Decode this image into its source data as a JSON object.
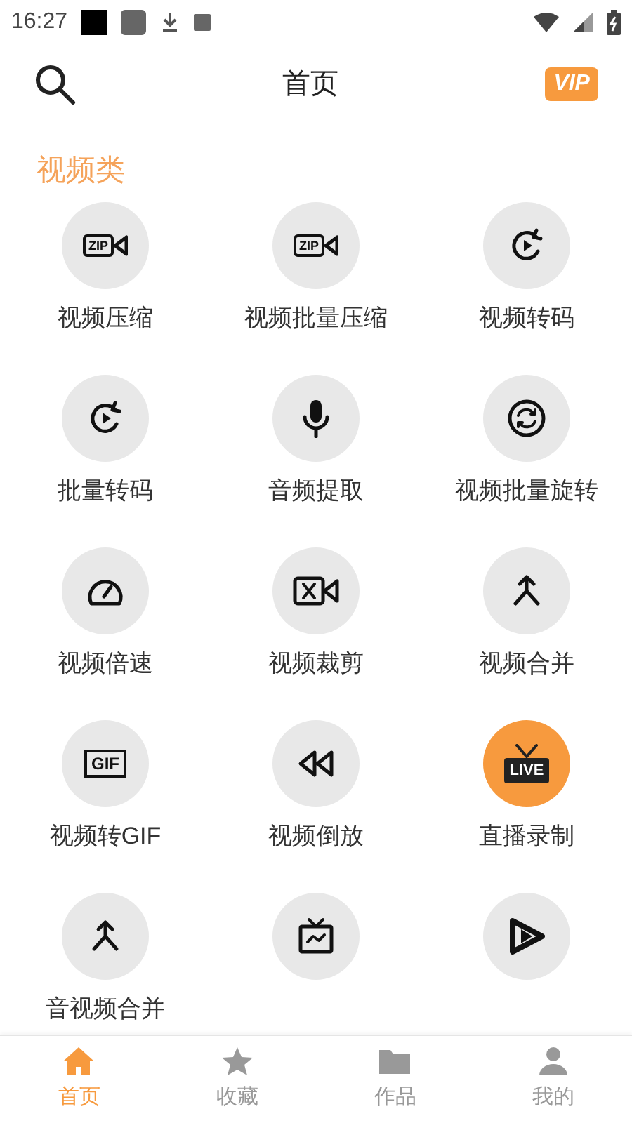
{
  "status_bar": {
    "time": "16:27"
  },
  "header": {
    "title": "首页",
    "vip_badge": "VIP"
  },
  "section": {
    "title": "视频类"
  },
  "tools": [
    {
      "label": "视频压缩",
      "kind": "zip",
      "icon_text": "ZIP",
      "color": "#e8e8e8"
    },
    {
      "label": "视频批量压缩",
      "kind": "zip",
      "icon_text": "ZIP",
      "color": "#e8e8e8"
    },
    {
      "label": "视频转码",
      "kind": "convert",
      "color": "#e8e8e8"
    },
    {
      "label": "批量转码",
      "kind": "convert",
      "color": "#e8e8e8"
    },
    {
      "label": "音频提取",
      "kind": "mic",
      "color": "#e8e8e8"
    },
    {
      "label": "视频批量旋转",
      "kind": "rotate",
      "color": "#e8e8e8"
    },
    {
      "label": "视频倍速",
      "kind": "speed",
      "color": "#e8e8e8"
    },
    {
      "label": "视频裁剪",
      "kind": "cut",
      "color": "#e8e8e8"
    },
    {
      "label": "视频合并",
      "kind": "merge",
      "color": "#e8e8e8"
    },
    {
      "label": "视频转GIF",
      "kind": "gif",
      "icon_text": "GIF",
      "color": "#e8e8e8"
    },
    {
      "label": "视频倒放",
      "kind": "rewind",
      "color": "#e8e8e8"
    },
    {
      "label": "直播录制",
      "kind": "live",
      "icon_text": "LIVE",
      "color": "#f79a3e"
    },
    {
      "label": "音视频合并",
      "kind": "merge",
      "color": "#e8e8e8"
    },
    {
      "kind": "tv",
      "color": "#e8e8e8"
    },
    {
      "kind": "play",
      "color": "#e8e8e8"
    }
  ],
  "nav": [
    {
      "label": "首页",
      "kind": "home",
      "selected": true
    },
    {
      "label": "收藏",
      "kind": "star",
      "selected": false
    },
    {
      "label": "作品",
      "kind": "folder",
      "selected": false
    },
    {
      "label": "我的",
      "kind": "person",
      "selected": false
    }
  ]
}
